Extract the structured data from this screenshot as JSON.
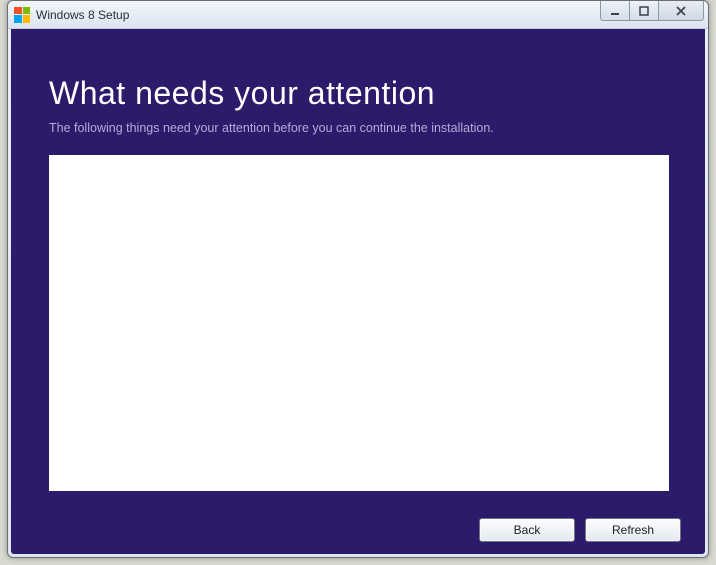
{
  "window": {
    "title": "Windows 8 Setup"
  },
  "main": {
    "heading": "What needs your attention",
    "subtext": "The following things need your attention before you can continue the installation."
  },
  "footer": {
    "back_label": "Back",
    "refresh_label": "Refresh"
  },
  "colors": {
    "accent": "#2c1a6b"
  }
}
